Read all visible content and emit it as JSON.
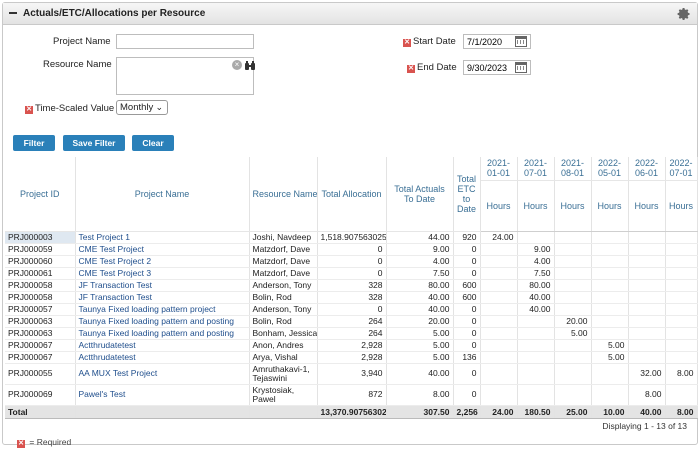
{
  "panel": {
    "title": "Actuals/ETC/Allocations per Resource"
  },
  "filters": {
    "project_name_label": "Project Name",
    "project_name_value": "",
    "resource_name_label": "Resource Name",
    "resource_name_value": "",
    "start_date_label": "Start Date",
    "start_date_value": "7/1/2020",
    "end_date_label": "End Date",
    "end_date_value": "9/30/2023",
    "time_scaled_label": "Time-Scaled Value",
    "time_scaled_value": "Monthly"
  },
  "buttons": {
    "filter": "Filter",
    "save_filter": "Save Filter",
    "clear": "Clear"
  },
  "table": {
    "columns": [
      "Project ID",
      "Project Name",
      "Resource Name",
      "Total Allocation",
      "Total Actuals To Date",
      "Total ETC to Date"
    ],
    "periods": [
      "2021-01-01",
      "2021-07-01",
      "2021-08-01",
      "2022-05-01",
      "2022-06-01",
      "2022-07-01"
    ],
    "period_unit": "Hours",
    "rows": [
      {
        "id": "PRJ000003",
        "project": "Test Project 1",
        "resource": "Joshi, Navdeep",
        "alloc": "1,518.907563025",
        "actuals": "44.00",
        "etc": "920",
        "p": [
          "24.00",
          "",
          "",
          "",
          "",
          ""
        ]
      },
      {
        "id": "PRJ000059",
        "project": "CME Test Project",
        "resource": "Matzdorf, Dave",
        "alloc": "0",
        "actuals": "9.00",
        "etc": "0",
        "p": [
          "",
          "9.00",
          "",
          "",
          "",
          ""
        ]
      },
      {
        "id": "PRJ000060",
        "project": "CME Test Project 2",
        "resource": "Matzdorf, Dave",
        "alloc": "0",
        "actuals": "4.00",
        "etc": "0",
        "p": [
          "",
          "4.00",
          "",
          "",
          "",
          ""
        ]
      },
      {
        "id": "PRJ000061",
        "project": "CME Test Project 3",
        "resource": "Matzdorf, Dave",
        "alloc": "0",
        "actuals": "7.50",
        "etc": "0",
        "p": [
          "",
          "7.50",
          "",
          "",
          "",
          ""
        ]
      },
      {
        "id": "PRJ000058",
        "project": "JF Transaction Test",
        "resource": "Anderson, Tony",
        "alloc": "328",
        "actuals": "80.00",
        "etc": "600",
        "p": [
          "",
          "80.00",
          "",
          "",
          "",
          ""
        ]
      },
      {
        "id": "PRJ000058",
        "project": "JF Transaction Test",
        "resource": "Bolin, Rod",
        "alloc": "328",
        "actuals": "40.00",
        "etc": "600",
        "p": [
          "",
          "40.00",
          "",
          "",
          "",
          ""
        ]
      },
      {
        "id": "PRJ000057",
        "project": "Taunya Fixed loading pattern project",
        "resource": "Anderson, Tony",
        "alloc": "0",
        "actuals": "40.00",
        "etc": "0",
        "p": [
          "",
          "40.00",
          "",
          "",
          "",
          ""
        ]
      },
      {
        "id": "PRJ000063",
        "project": "Taunya Fixed loading pattern and posting",
        "resource": "Bolin, Rod",
        "alloc": "264",
        "actuals": "20.00",
        "etc": "0",
        "p": [
          "",
          "",
          "20.00",
          "",
          "",
          ""
        ]
      },
      {
        "id": "PRJ000063",
        "project": "Taunya Fixed loading pattern and posting",
        "resource": "Bonham, Jessica",
        "alloc": "264",
        "actuals": "5.00",
        "etc": "0",
        "p": [
          "",
          "",
          "5.00",
          "",
          "",
          ""
        ]
      },
      {
        "id": "PRJ000067",
        "project": "Actthrudatetest",
        "resource": "Anon, Andres",
        "alloc": "2,928",
        "actuals": "5.00",
        "etc": "0",
        "p": [
          "",
          "",
          "",
          "5.00",
          "",
          ""
        ]
      },
      {
        "id": "PRJ000067",
        "project": "Actthrudatetest",
        "resource": "Arya, Vishal",
        "alloc": "2,928",
        "actuals": "5.00",
        "etc": "136",
        "p": [
          "",
          "",
          "",
          "5.00",
          "",
          ""
        ]
      },
      {
        "id": "PRJ000055",
        "project": "AA MUX Test Project",
        "resource": "Amruthakavi-1, Tejaswini",
        "alloc": "3,940",
        "actuals": "40.00",
        "etc": "0",
        "p": [
          "",
          "",
          "",
          "",
          "32.00",
          "8.00"
        ]
      },
      {
        "id": "PRJ000069",
        "project": "Pawel's Test",
        "resource": "Krystosiak, Pawel",
        "alloc": "872",
        "actuals": "8.00",
        "etc": "0",
        "p": [
          "",
          "",
          "",
          "",
          "8.00",
          ""
        ]
      }
    ],
    "total": {
      "label": "Total",
      "alloc": "13,370.907563025",
      "actuals": "307.50",
      "etc": "2,256",
      "p": [
        "24.00",
        "180.50",
        "25.00",
        "10.00",
        "40.00",
        "8.00"
      ]
    },
    "displaying": "Displaying 1 - 13 of 13"
  },
  "footer": {
    "required_note": "= Required"
  }
}
